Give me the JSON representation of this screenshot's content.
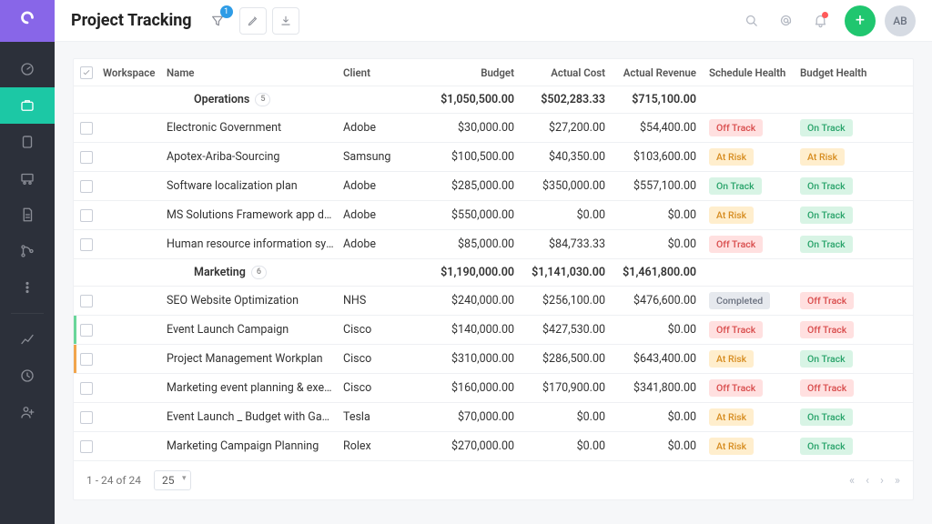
{
  "header": {
    "title": "Project Tracking",
    "filter_badge": "1",
    "avatar": "AB"
  },
  "columns": {
    "workspace": "Workspace",
    "name": "Name",
    "client": "Client",
    "budget": "Budget",
    "actual_cost": "Actual Cost",
    "actual_revenue": "Actual Revenue",
    "schedule_health": "Schedule Health",
    "budget_health": "Budget Health"
  },
  "groups": [
    {
      "name": "Operations",
      "count": "5",
      "budget": "$1,050,500.00",
      "actual_cost": "$502,283.33",
      "actual_revenue": "$715,100.00",
      "rows": [
        {
          "name": "Electronic Government",
          "client": "Adobe",
          "budget": "$30,000.00",
          "cost": "$27,200.00",
          "revenue": "$54,400.00",
          "sched": "Off Track",
          "bud": "On Track"
        },
        {
          "name": "Apotex-Ariba-Sourcing",
          "client": "Samsung",
          "budget": "$100,500.00",
          "cost": "$40,350.00",
          "revenue": "$103,600.00",
          "sched": "At Risk",
          "bud": "At Risk"
        },
        {
          "name": "Software localization plan",
          "client": "Adobe",
          "budget": "$285,000.00",
          "cost": "$350,000.00",
          "revenue": "$557,100.00",
          "sched": "On Track",
          "bud": "On Track"
        },
        {
          "name": "MS Solutions Framework app devel…",
          "client": "Adobe",
          "budget": "$550,000.00",
          "cost": "$0.00",
          "revenue": "$0.00",
          "sched": "At Risk",
          "bud": "On Track"
        },
        {
          "name": "Human resource information syste…",
          "client": "Adobe",
          "budget": "$85,000.00",
          "cost": "$84,733.33",
          "revenue": "$0.00",
          "sched": "Off Track",
          "bud": "On Track"
        }
      ]
    },
    {
      "name": "Marketing",
      "count": "6",
      "budget": "$1,190,000.00",
      "actual_cost": "$1,141,030.00",
      "actual_revenue": "$1,461,800.00",
      "rows": [
        {
          "name": "SEO Website Optimization",
          "client": "NHS",
          "budget": "$240,000.00",
          "cost": "$256,100.00",
          "revenue": "$476,600.00",
          "sched": "Completed",
          "bud": "Off Track"
        },
        {
          "name": "Event Launch Campaign",
          "client": "Cisco",
          "budget": "$140,000.00",
          "cost": "$427,530.00",
          "revenue": "$0.00",
          "sched": "Off Track",
          "bud": "Off Track",
          "edge": "green"
        },
        {
          "name": "Project Management Workplan",
          "client": "Cisco",
          "budget": "$310,000.00",
          "cost": "$286,500.00",
          "revenue": "$643,400.00",
          "sched": "At Risk",
          "bud": "On Track",
          "edge": "orange"
        },
        {
          "name": "Marketing event planning & executi…",
          "client": "Cisco",
          "budget": "$160,000.00",
          "cost": "$170,900.00",
          "revenue": "$341,800.00",
          "sched": "Off Track",
          "bud": "Off Track"
        },
        {
          "name": "Event Launch _ Budget with Gantt …",
          "client": "Tesla",
          "budget": "$70,000.00",
          "cost": "$0.00",
          "revenue": "$0.00",
          "sched": "At Risk",
          "bud": "On Track"
        },
        {
          "name": "Marketing Campaign Planning",
          "client": "Rolex",
          "budget": "$270,000.00",
          "cost": "$0.00",
          "revenue": "$0.00",
          "sched": "At Risk",
          "bud": "On Track"
        }
      ]
    }
  ],
  "pager": {
    "range": "1 - 24 of 24",
    "page_size": "25"
  },
  "badge_class": {
    "On Track": "ontrack",
    "Off Track": "offtrack",
    "At Risk": "atrisk",
    "Completed": "completed"
  }
}
